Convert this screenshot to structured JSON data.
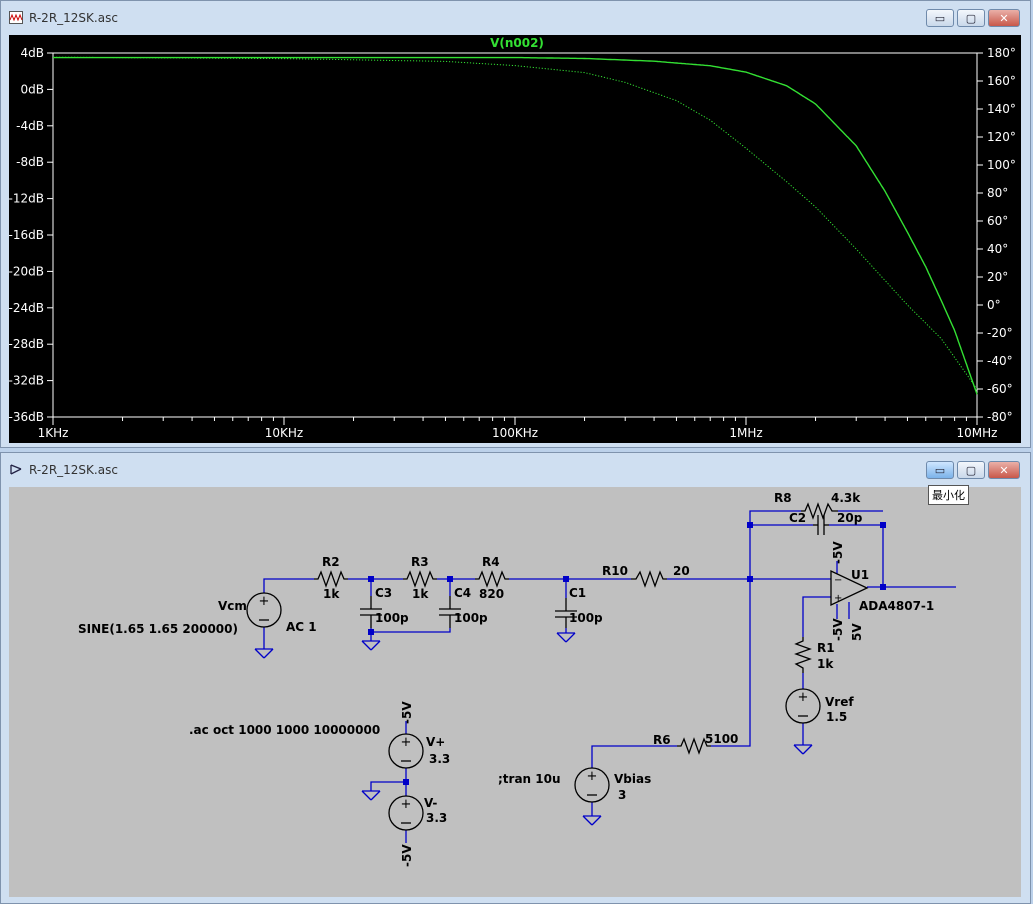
{
  "plot_window": {
    "title": "R-2R_12SK.asc"
  },
  "schematic_window": {
    "title": "R-2R_12SK.asc"
  },
  "window_buttons": {
    "minimize": "▭",
    "restore": "▢",
    "close": "✕"
  },
  "tooltip": {
    "text": "最小化"
  },
  "colors": {
    "trace": "#33e033",
    "axis_text": "#ffffff",
    "wire": "#0000c8",
    "component": "#000000"
  },
  "chart_data": {
    "type": "line",
    "title": "V(n002)",
    "x_scale": "log",
    "x_range": [
      1000,
      10000000
    ],
    "x_ticks": [
      {
        "value": 1000,
        "label": "1KHz"
      },
      {
        "value": 10000,
        "label": "10KHz"
      },
      {
        "value": 100000,
        "label": "100KHz"
      },
      {
        "value": 1000000,
        "label": "1MHz"
      },
      {
        "value": 10000000,
        "label": "10MHz"
      }
    ],
    "y_left_range": [
      -36,
      4
    ],
    "y_left_ticks": [
      "4dB",
      "0dB",
      "-4dB",
      "-8dB",
      "-12dB",
      "-16dB",
      "-20dB",
      "-24dB",
      "-28dB",
      "-32dB",
      "-36dB"
    ],
    "y_left_values": [
      4,
      0,
      -4,
      -8,
      -12,
      -16,
      -20,
      -24,
      -28,
      -32,
      -36
    ],
    "y_right_range": [
      -80,
      180
    ],
    "y_right_ticks": [
      "180°",
      "160°",
      "140°",
      "120°",
      "100°",
      "80°",
      "60°",
      "40°",
      "20°",
      "0°",
      "-20°",
      "-40°",
      "-60°",
      "-80°"
    ],
    "y_right_values": [
      180,
      160,
      140,
      120,
      100,
      80,
      60,
      40,
      20,
      0,
      -20,
      -40,
      -60,
      -80
    ],
    "series": [
      {
        "name": "V(n002)",
        "axis": "left",
        "style": "solid",
        "x": [
          1000,
          10000,
          100000,
          200000,
          400000,
          700000,
          1000000,
          1500000,
          2000000,
          3000000,
          4000000,
          5000000,
          6000000,
          7000000,
          8000000,
          10000000
        ],
        "y": [
          3.5,
          3.5,
          3.5,
          3.4,
          3.1,
          2.6,
          1.9,
          0.4,
          -1.6,
          -6.2,
          -11.2,
          -15.7,
          -19.5,
          -23.2,
          -26.5,
          -33.5
        ]
      },
      {
        "name": "phase",
        "axis": "right",
        "style": "dotted",
        "x": [
          1000,
          10000,
          50000,
          100000,
          200000,
          300000,
          500000,
          700000,
          1000000,
          1500000,
          2000000,
          3000000,
          5000000,
          7000000,
          10000000
        ],
        "y": [
          177,
          176,
          174,
          171,
          166,
          159,
          146,
          132,
          112,
          88,
          70,
          40,
          0,
          -24,
          -60
        ]
      }
    ]
  },
  "schematic": {
    "labels": {
      "r8": "R8",
      "r8_val": "4.3k",
      "c2": "C2",
      "c2_val": "20p",
      "r2": "R2",
      "r2_val": "1k",
      "r3": "R3",
      "r3_val": "1k",
      "r4": "R4",
      "r4_val": "820",
      "r10": "R10",
      "r10_val": "20",
      "c3": "C3",
      "c3_val": "100p",
      "c4": "C4",
      "c4_val": "100p",
      "c1": "C1",
      "c1_val": "100p",
      "vcm": "Vcm",
      "vcm_ac": "AC 1",
      "vcm_sine": "SINE(1.65 1.65 200000)",
      "u1": "U1",
      "u1_part": "ADA4807-1",
      "neg5": "-5V",
      "pos5": "5V",
      "r1": "R1",
      "r1_val": "1k",
      "vref": "Vref",
      "vref_val": "1.5",
      "ac_cmd": ".ac oct 1000 1000 10000000",
      "tran_cmd": ";tran 10u",
      "vplus": "V+",
      "vplus_val": "3.3",
      "vminus": "V-",
      "vminus_val": "3.3",
      "r6": "R6",
      "r6_val": "5100",
      "vbias": "Vbias",
      "vbias_val": "3"
    }
  }
}
